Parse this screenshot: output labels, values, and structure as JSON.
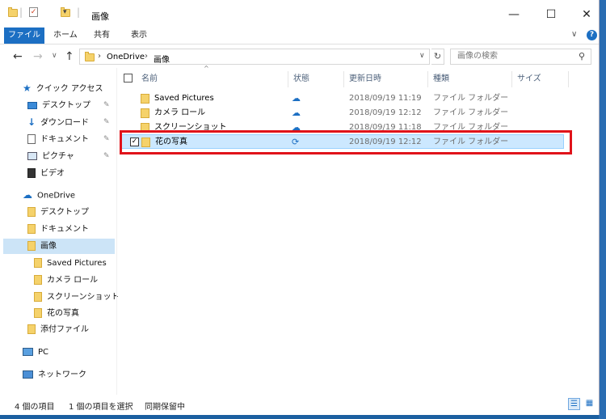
{
  "window": {
    "title": "画像",
    "minimize": "—",
    "maximize": "☐",
    "close": "✕"
  },
  "ribbon": {
    "tabs": [
      "ファイル",
      "ホーム",
      "共有",
      "表示"
    ],
    "help": "?"
  },
  "address": {
    "crumbs": [
      "OneDrive",
      "画像"
    ],
    "search_placeholder": "画像の検索"
  },
  "nav": {
    "quick_access": "クイック アクセス",
    "quick_items": [
      "デスクトップ",
      "ダウンロード",
      "ドキュメント",
      "ピクチャ",
      "ビデオ"
    ],
    "onedrive": "OneDrive",
    "onedrive_items": [
      "デスクトップ",
      "ドキュメント",
      "画像"
    ],
    "image_subfolders": [
      "Saved Pictures",
      "カメラ ロール",
      "スクリーンショット",
      "花の写真"
    ],
    "onedrive_more": [
      "添付ファイル"
    ],
    "pc": "PC",
    "network": "ネットワーク"
  },
  "columns": {
    "name": "名前",
    "status": "状態",
    "date": "更新日時",
    "type": "種類",
    "size": "サイズ"
  },
  "files": [
    {
      "name": "Saved Pictures",
      "status": "cloud",
      "date": "2018/09/19 11:19",
      "type": "ファイル フォルダー"
    },
    {
      "name": "カメラ ロール",
      "status": "cloud",
      "date": "2018/09/19 12:12",
      "type": "ファイル フォルダー"
    },
    {
      "name": "スクリーンショット",
      "status": "cloud",
      "date": "2018/09/19 11:18",
      "type": "ファイル フォルダー"
    },
    {
      "name": "花の写真",
      "status": "sync",
      "date": "2018/09/19 12:12",
      "type": "ファイル フォルダー"
    }
  ],
  "statusbar": {
    "count": "4 個の項目",
    "selected": "1 個の項目を選択",
    "sync": "同期保留中"
  },
  "colors": {
    "accent": "#1c6fc3",
    "selection": "#cce8ff",
    "highlight_border": "#e0131a"
  }
}
